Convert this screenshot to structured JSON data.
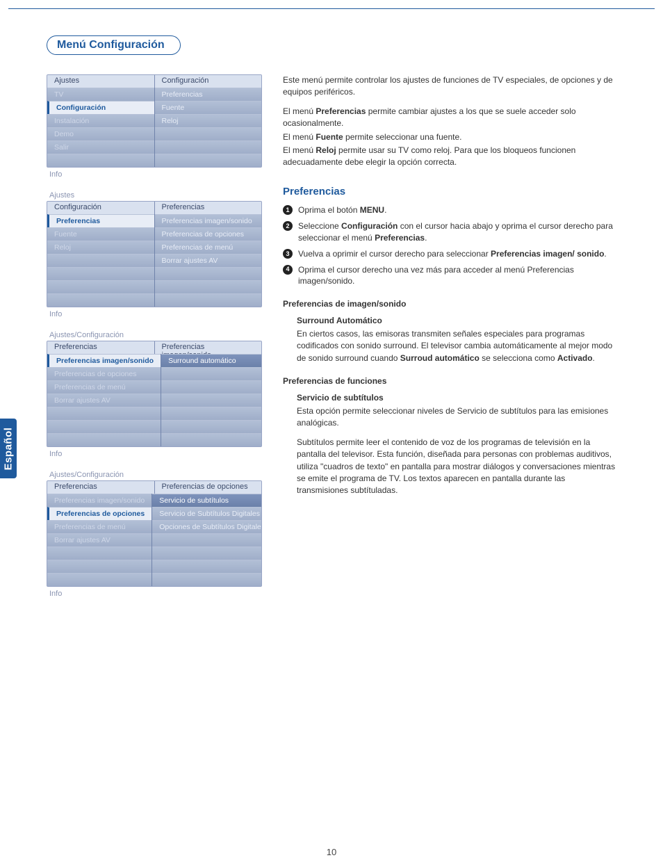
{
  "page": {
    "section_title": "Menú Configuración",
    "side_tab": "Español",
    "page_number": "10"
  },
  "screenshots": {
    "s1": {
      "head_left": "Ajustes",
      "head_right": "Configuración",
      "left": [
        "TV",
        "Configuración",
        "Instalación",
        "Demo",
        "Salir",
        ""
      ],
      "left_selected_index": 1,
      "right": [
        "Preferencias",
        "Fuente",
        "Reloj",
        "",
        "",
        ""
      ],
      "caption": "Info"
    },
    "s2": {
      "breadcrumb": "Ajustes",
      "head_left": "Configuración",
      "head_right": "Preferencias",
      "left": [
        "Preferencias",
        "Fuente",
        "Reloj",
        "",
        "",
        "",
        ""
      ],
      "left_selected_index": 0,
      "right": [
        "Preferencias imagen/sonido",
        "Preferencias de opciones",
        "Preferencias de menú",
        "Borrar ajustes AV",
        "",
        "",
        ""
      ],
      "caption": "Info"
    },
    "s3": {
      "breadcrumb": "Ajustes/Configuración",
      "head_left": "Preferencias",
      "head_right": "Preferencias imagen/sonido",
      "left": [
        "Preferencias imagen/sonido",
        "Preferencias de opciones",
        "Preferencias de menú",
        "Borrar ajustes AV",
        "",
        "",
        ""
      ],
      "left_selected_index": 0,
      "right": [
        "Surround automático",
        "",
        "",
        "",
        "",
        "",
        ""
      ],
      "right_hl_index": 0,
      "caption": "Info"
    },
    "s4": {
      "breadcrumb": "Ajustes/Configuración",
      "head_left": "Preferencias",
      "head_right": "Preferencias de opciones",
      "left": [
        "Preferencias imagen/sonido",
        "Preferencias de opciones",
        "Preferencias de menú",
        "Borrar ajustes AV",
        "",
        "",
        ""
      ],
      "left_selected_index": 1,
      "right": [
        "Servicio de subtítulos",
        "Servicio de Subtítulos Digitales",
        "Opciones de Subtítulos Digitales",
        "",
        "",
        "",
        ""
      ],
      "right_hl_index": 0,
      "caption": "Info"
    }
  },
  "body": {
    "intro": "Este menú permite controlar los ajustes de funciones de TV especiales, de opciones y de equipos periféricos.",
    "pref_line_a": "El menú ",
    "pref_bold": "Preferencias",
    "pref_line_b": " permite cambiar ajustes a los que se suele acceder solo ocasionalmente.",
    "fuente_a": "El menú ",
    "fuente_bold": "Fuente",
    "fuente_b": " permite seleccionar una fuente.",
    "reloj_a": "El menú ",
    "reloj_bold": "Reloj",
    "reloj_b": " permite usar su TV como reloj. Para que los bloqueos funcionen adecuadamente debe elegir la opción correcta.",
    "h_preferencias": "Preferencias",
    "steps": {
      "s1_a": "Oprima el botón ",
      "s1_bold": "MENU",
      "s1_b": ".",
      "s2_a": "Seleccione ",
      "s2_bold": "Configuración",
      "s2_b": " con el cursor hacia abajo y oprima el cursor derecho para seleccionar el menú ",
      "s2_bold2": "Preferencias",
      "s2_c": ".",
      "s3_a": "Vuelva a oprimir el cursor derecho para seleccionar ",
      "s3_bold": "Preferencias imagen/ sonido",
      "s3_b": ".",
      "s4_a": "Oprima el cursor derecho una vez más para acceder al menú Preferencias imagen/sonido."
    },
    "h_imgsonido": "Preferencias de imagen/sonido",
    "surround_h": "Surround Automático",
    "surround_a": "En ciertos casos, las emisoras transmiten señales especiales para programas codificados con sonido surround. El televisor cambia automáticamente al mejor modo de sonido surround cuando ",
    "surround_bold": "Surroud automático",
    "surround_b": " se selecciona como ",
    "surround_bold2": "Activado",
    "surround_c": ".",
    "h_funciones": "Preferencias de funciones",
    "sub_h": "Servicio de subtítulos",
    "sub_p1": "Esta opción permite seleccionar niveles de Servicio de subtítulos para las emisiones analógicas.",
    "sub_p2": "Subtítulos permite leer el contenido de voz de los programas de televisión en la pantalla del televisor. Esta función, diseñada para personas con problemas auditivos, utiliza \"cuadros de texto\" en pantalla para mostrar diálogos y conversaciones mientras se emite el programa de TV. Los textos aparecen en pantalla durante las transmisiones subtítuladas."
  }
}
